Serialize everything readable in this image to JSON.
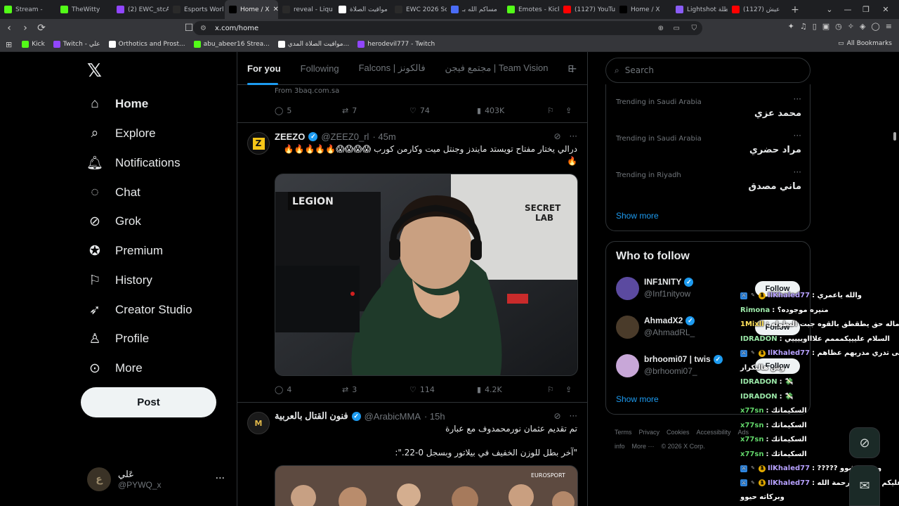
{
  "browser": {
    "tabs": [
      {
        "label": "Stream -",
        "icon": "kick-icon",
        "color": "#53fc18"
      },
      {
        "label": "TheWitty",
        "icon": "kick-icon",
        "color": "#53fc18"
      },
      {
        "label": "(2) EWC_stcA",
        "icon": "twitch-icon",
        "color": "#9146ff"
      },
      {
        "label": "Esports Worl",
        "icon": "ewc-icon",
        "color": "#2a2a2a"
      },
      {
        "label": "Home / X",
        "icon": "x-icon",
        "color": "#000000",
        "active": true
      },
      {
        "label": "reveal - Liqu",
        "icon": "liquipedia-icon",
        "color": "#2a2a2a"
      },
      {
        "label": "مواقيت الصلاة",
        "icon": "google-icon",
        "color": "#ffffff"
      },
      {
        "label": "EWC 2026 Sc",
        "icon": "ewc-icon",
        "color": "#2a2a2a"
      },
      {
        "label": "مساكم الله بـ",
        "icon": "r-icon",
        "color": "#4a6cf7"
      },
      {
        "label": "Emotes - Kick",
        "icon": "kick-icon",
        "color": "#53fc18"
      },
      {
        "label": "(1127) YouTu",
        "icon": "youtube-icon",
        "color": "#ff0000"
      },
      {
        "label": "Home / X",
        "icon": "x-icon",
        "color": "#000000"
      },
      {
        "label": "Lightshot ظلة",
        "icon": "lightshot-icon",
        "color": "#8a5cf6"
      },
      {
        "label": "(1127) عيش",
        "icon": "youtube-icon",
        "color": "#ff0000"
      }
    ],
    "url": "x.com/home",
    "bookmarks": [
      {
        "label": "Kick",
        "color": "#53fc18"
      },
      {
        "label": "Twitch - علي",
        "color": "#9146ff"
      },
      {
        "label": "Orthotics and Prost...",
        "color": "#ffffff"
      },
      {
        "label": "abu_abeer16 Strea...",
        "color": "#53fc18"
      },
      {
        "label": "موافيت الصلاة المدي...",
        "color": "#ffffff"
      },
      {
        "label": "herodevil777 - Twitch",
        "color": "#9146ff"
      }
    ],
    "all_bookmarks": "All Bookmarks"
  },
  "nav": {
    "items": [
      {
        "label": "Home",
        "icon": "home-icon"
      },
      {
        "label": "Explore",
        "icon": "search-icon"
      },
      {
        "label": "Notifications",
        "icon": "bell-icon"
      },
      {
        "label": "Chat",
        "icon": "chat-icon"
      },
      {
        "label": "Grok",
        "icon": "grok-icon"
      },
      {
        "label": "Premium",
        "icon": "premium-icon"
      },
      {
        "label": "History",
        "icon": "bookmark-icon"
      },
      {
        "label": "Creator Studio",
        "icon": "rocket-icon"
      },
      {
        "label": "Profile",
        "icon": "person-icon"
      },
      {
        "label": "More",
        "icon": "more-icon"
      }
    ],
    "post": "Post",
    "account": {
      "name": "عَلي",
      "handle": "@PYWQ_x"
    }
  },
  "feed": {
    "tabs": [
      "For you",
      "Following",
      "Falcons | فالكونز",
      "مجتمع فيجن | Team Vision",
      "E"
    ],
    "prev_tweet": {
      "source": "From 3baq.com.sa",
      "replies": "5",
      "reposts": "7",
      "likes": "74",
      "views": "403K"
    },
    "tweets": [
      {
        "name": "ZEEZO",
        "handle": "@ZEEZ0_rl",
        "time": "· 45m",
        "text": "درالي يختار مفتاح تويستد مايندز وجنتل ميت وكارمن كورب 😱😱😱😱🔥🔥🔥🔥🔥🔥",
        "replies": "4",
        "reposts": "3",
        "likes": "114",
        "views": "4.2K"
      },
      {
        "name": "فنون القتال بالعربية",
        "handle": "@ArabicMMA",
        "time": "· 15h",
        "text1": "تم تقديم عثمان نورمحمدوف مع عبارة",
        "text2": "\"آخر بطل للوزن الخفيف في بيلاتور وبسجل 0-22.\":",
        "media_label": "EUROSPORT"
      }
    ],
    "media_signs": {
      "left": "LEGION",
      "right1": "SECRET",
      "right2": "LAB"
    }
  },
  "right": {
    "search_placeholder": "Search",
    "trends": [
      {
        "context": "Trending in Saudi Arabia",
        "title": "محمد عزي"
      },
      {
        "context": "Trending in Saudi Arabia",
        "title": "مراد حضري"
      },
      {
        "context": "Trending in Riyadh",
        "title": "ماني مصدق"
      }
    ],
    "show_more": "Show more",
    "wtf_title": "Who to follow",
    "follow": [
      {
        "name": "INF1NITY",
        "handle": "@Inf1nityow",
        "color": "#5b4aa0"
      },
      {
        "name": "AhmadX2",
        "handle": "@AhmadRL_",
        "color": "#4a3b2a"
      },
      {
        "name": "brhoomi07 | twis",
        "handle": "@brhoomi07_",
        "color": "#c8a7d8"
      }
    ],
    "follow_label": "Follow",
    "show_more2": "Show more",
    "footer": [
      "Terms",
      "Privacy",
      "Cookies",
      "Accessibility",
      "Ads info",
      "More ···",
      "© 2026 X Corp."
    ]
  },
  "chat": [
    {
      "user": "IlKhaled77",
      "msg": ": والله ياعمري",
      "color": "#b7a1ff",
      "badges": true
    },
    {
      "user": "Rimona",
      "msg": ": منيره موجوده؟",
      "color": "#9be8a8",
      "badges": false
    },
    {
      "user": "1Mixll",
      "msg": ": ماله حق يطقطق بالقوه جبت البطوله",
      "color": "#ffe25c",
      "badges": false
    },
    {
      "user": "IDRADON",
      "msg": ": السلام عليييكمممم علاااوييييي",
      "color": "#9be8a8",
      "badges": false
    },
    {
      "user": "IlKhaled77",
      "msg": ": حتى تدري مدريهم عظاهم",
      "color": "#b7a1ff",
      "badges": true
    },
    {
      "user": "",
      "msg": "وش هالتكرار",
      "color": "#ffffff",
      "badges": false
    },
    {
      "user": "IDRADON",
      "msg": ": 💸",
      "color": "#9be8a8",
      "badges": false
    },
    {
      "user": "IDRADON",
      "msg": ": 💸",
      "color": "#9be8a8",
      "badges": false
    },
    {
      "user": "x77sn",
      "msg": ": السكيماتك",
      "color": "#62d66a",
      "badges": false
    },
    {
      "user": "x77sn",
      "msg": ": السكيماتك",
      "color": "#62d66a",
      "badges": false
    },
    {
      "user": "x77sn",
      "msg": ": السكيماتك",
      "color": "#62d66a",
      "badges": false
    },
    {
      "user": "x77sn",
      "msg": ": السكيماتك",
      "color": "#62d66a",
      "badges": false
    },
    {
      "user": "IlKhaled77",
      "msg": ": ????? وششششوو",
      "color": "#b7a1ff",
      "badges": true
    },
    {
      "user": "IlKhaled77",
      "msg": ": وعليكم السلام ورحمة الله",
      "color": "#b7a1ff",
      "badges": true
    },
    {
      "user": "",
      "msg": "وبركاته حيوو",
      "color": "#ffffff",
      "badges": false
    }
  ]
}
